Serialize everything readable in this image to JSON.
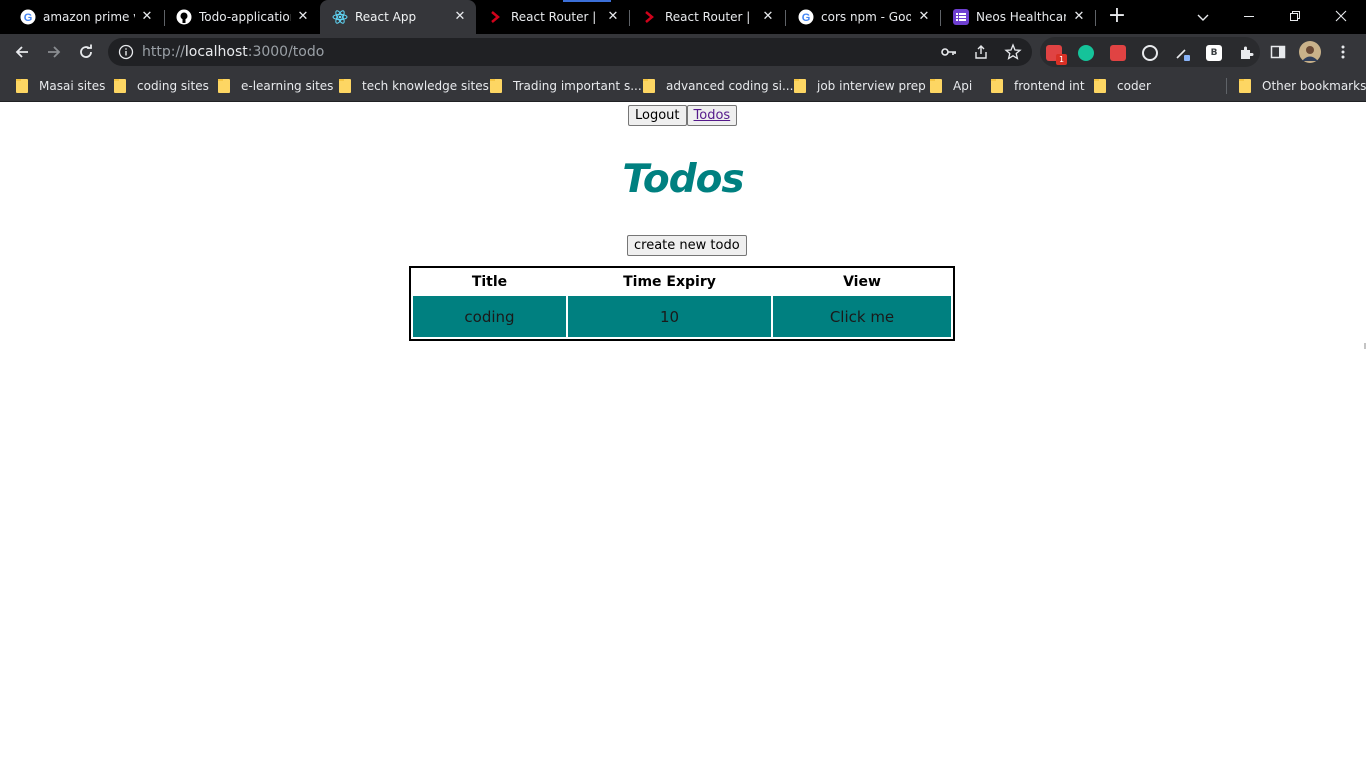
{
  "browser": {
    "tabs": [
      {
        "title": "amazon prime vid",
        "favicon": "google-g-icon"
      },
      {
        "title": "Todo-application",
        "favicon": "github-icon"
      },
      {
        "title": "React App",
        "favicon": "react-icon",
        "active": true
      },
      {
        "title": "React Router | Na",
        "favicon": "react-router-icon"
      },
      {
        "title": "React Router | Ins",
        "favicon": "react-router-icon"
      },
      {
        "title": "cors npm - Goog",
        "favicon": "google-g-icon"
      },
      {
        "title": "Neos Healthcare",
        "favicon": "purple-list-icon"
      }
    ],
    "url": {
      "scheme": "http://",
      "host": "localhost",
      "rest": ":3000/todo"
    },
    "bookmarks": [
      "Masai sites",
      "coding sites",
      "e-learning sites",
      "tech knowledge sites",
      "Trading important s...",
      "advanced coding si...",
      "job interview prep",
      "Api",
      "frontend int",
      "coder"
    ],
    "other_bookmarks": "Other bookmarks",
    "extension_badge": "1",
    "extension_b_label": "B"
  },
  "app": {
    "nav": {
      "logout_label": "Logout",
      "todos_link_label": "Todos"
    },
    "title": "Todos",
    "create_button_label": "create new todo",
    "table": {
      "headers": [
        "Title",
        "Time Expiry",
        "View"
      ],
      "rows": [
        [
          "coding",
          "10",
          "Click me"
        ]
      ]
    }
  },
  "colors": {
    "accent": "#008080",
    "tabstrip": "#000000",
    "toolbar": "#35363a"
  }
}
